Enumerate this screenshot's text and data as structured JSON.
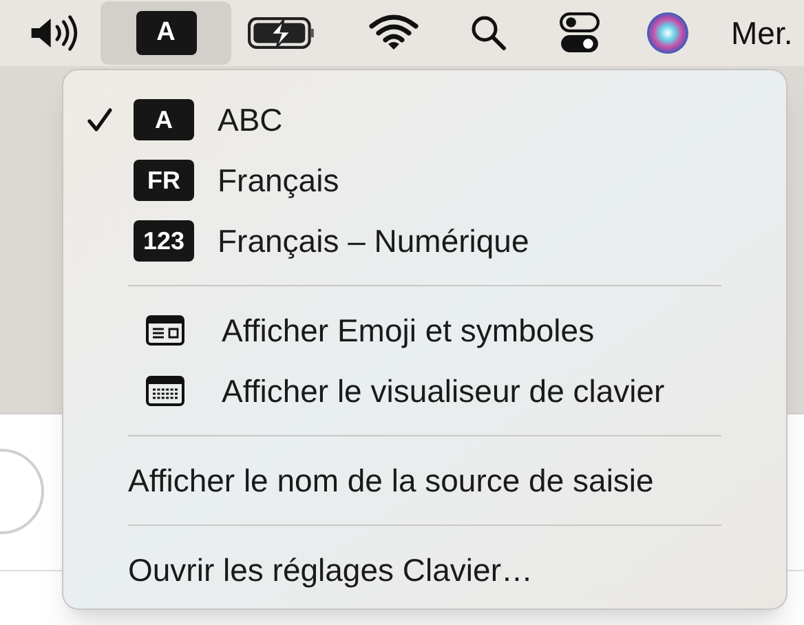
{
  "menu_bar": {
    "input_source": {
      "badge": "A",
      "selected": true
    },
    "clock": "Mer."
  },
  "menu": {
    "items": [
      {
        "kind": "source",
        "badge": "A",
        "label": "ABC",
        "checked": true
      },
      {
        "kind": "source",
        "badge": "FR",
        "label": "Français",
        "checked": false
      },
      {
        "kind": "source",
        "badge": "123",
        "label": "Français – Numérique",
        "checked": false
      },
      {
        "kind": "separator"
      },
      {
        "kind": "emoji_viewer",
        "label": "Afficher Emoji et symboles"
      },
      {
        "kind": "keyboard_viewer",
        "label": "Afficher le visualiseur de clavier"
      },
      {
        "kind": "separator"
      },
      {
        "kind": "plain",
        "label": "Afficher le nom de la source de saisie"
      },
      {
        "kind": "separator"
      },
      {
        "kind": "plain",
        "label": "Ouvrir les réglages Clavier…"
      }
    ]
  }
}
